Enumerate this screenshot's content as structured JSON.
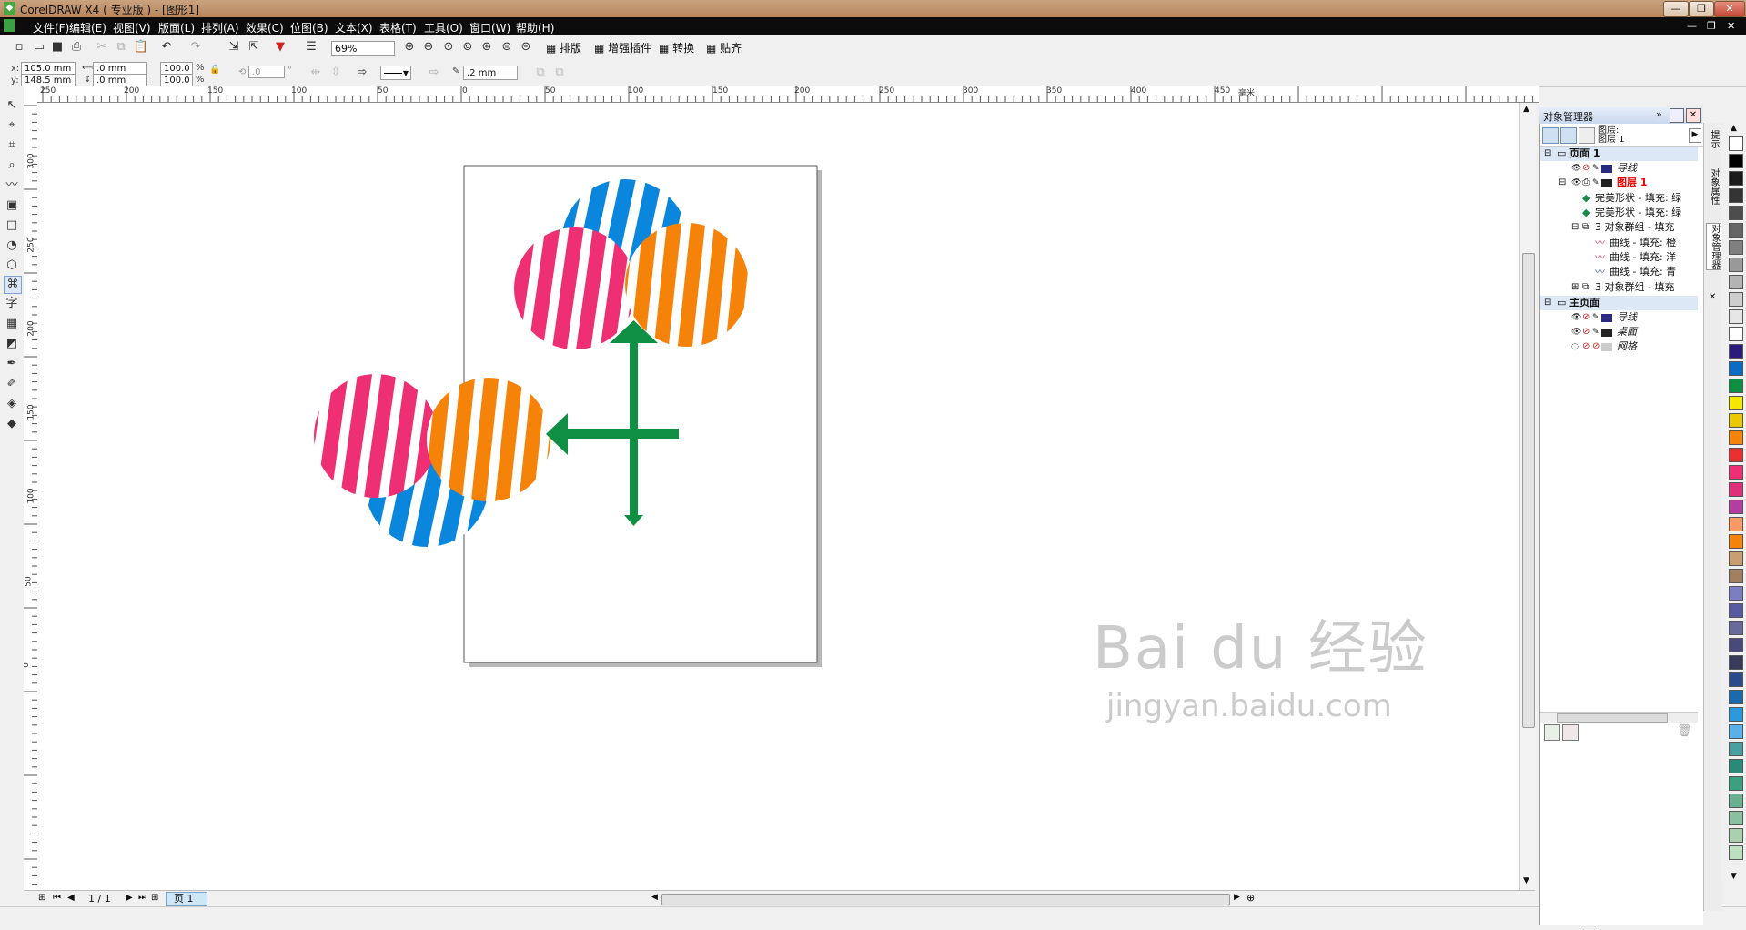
{
  "window": {
    "title": "CorelDRAW X4 ( 专业版 ) - [图形1]"
  },
  "menu": [
    "文件(F)",
    "编辑(E)",
    "视图(V)",
    "版面(L)",
    "排列(A)",
    "效果(C)",
    "位图(B)",
    "文本(X)",
    "表格(T)",
    "工具(O)",
    "窗口(W)",
    "帮助(H)"
  ],
  "toolbar": {
    "zoom": "69%",
    "plugins": [
      "排版",
      "增强插件",
      "转换",
      "贴齐"
    ]
  },
  "propbar": {
    "x_label": "x:",
    "x_value": "105.0 mm",
    "y_label": "y:",
    "y_value": "148.5 mm",
    "w_value": ".0 mm",
    "h_value": ".0 mm",
    "scale_x": "100.0",
    "scale_y": "100.0",
    "pct": "%",
    "angle": ".0",
    "deg": "°",
    "outline_width": ".2 mm"
  },
  "hruler": [
    "250",
    "200",
    "150",
    "100",
    "50",
    "0",
    "50",
    "100",
    "150",
    "200",
    "250",
    "300",
    "350",
    "400",
    "450"
  ],
  "hruler_unit": "毫米",
  "vruler": [
    "300",
    "250",
    "200",
    "150",
    "100",
    "50",
    "0"
  ],
  "navigator": {
    "page_count": "1 / 1",
    "page_tab": "页 1"
  },
  "docker": {
    "title": "对象管理器",
    "layer_info": [
      "图层:",
      "图层 1"
    ],
    "tree": [
      {
        "label": "页面 1",
        "type": "page"
      },
      {
        "label": "导线",
        "type": "layer",
        "color": "#2b2a7e"
      },
      {
        "label": "图层 1",
        "type": "layer-active",
        "color": "#222222"
      },
      {
        "label": "完美形状 - 填充: 绿",
        "type": "obj",
        "color": "#0e8f43"
      },
      {
        "label": "完美形状 - 填充: 绿",
        "type": "obj",
        "color": "#0e8f43"
      },
      {
        "label": "3 对象群组 - 填充",
        "type": "group"
      },
      {
        "label": "曲线 - 填充: 橙",
        "type": "curve",
        "color": "#e8326a"
      },
      {
        "label": "曲线 - 填充: 洋",
        "type": "curve",
        "color": "#e8326a"
      },
      {
        "label": "曲线 - 填充: 青",
        "type": "curve",
        "color": "#1f5a9a"
      },
      {
        "label": "3 对象群组 - 填充",
        "type": "group"
      },
      {
        "label": "主页面",
        "type": "page"
      },
      {
        "label": "导线",
        "type": "layer",
        "color": "#2b2a7e"
      },
      {
        "label": "桌面",
        "type": "layer",
        "color": "#222222"
      },
      {
        "label": "网格",
        "type": "layer",
        "color": "#cccccc"
      }
    ],
    "tabs": [
      "提示",
      "对象属性",
      "对象管理器"
    ]
  },
  "watermark": {
    "brand": "Bai du 经验",
    "url": "jingyan.baidu.com"
  },
  "colors": {
    "blue": "#0a87dc",
    "pink": "#ee2f73",
    "orange": "#f5830a",
    "green": "#0e8f43"
  },
  "palette": [
    "#ffffff",
    "#000000",
    "#1c1c1c",
    "#333333",
    "#4d4d4d",
    "#666666",
    "#808080",
    "#999999",
    "#b3b3b3",
    "#cccccc",
    "#e6e6e6",
    "#ffffff",
    "#2b1b7e",
    "#0a6cc4",
    "#0e8f43",
    "#f3e600",
    "#e8c800",
    "#f5830a",
    "#ee2f2f",
    "#ee2f73",
    "#e0307a",
    "#b33ea0",
    "#ff9966",
    "#f5830a",
    "#c8a070",
    "#a08060",
    "#7b7ec0",
    "#5a5aa0",
    "#6a6a9a",
    "#4a4a7a",
    "#3a3a5a",
    "#2a4a8a",
    "#1a6ab0",
    "#2a9adc",
    "#5ab0e8",
    "#4aa0a0",
    "#2a8a7a",
    "#3aa080",
    "#6ab090",
    "#8ac0a0",
    "#aad0b0",
    "#bde0c0"
  ]
}
